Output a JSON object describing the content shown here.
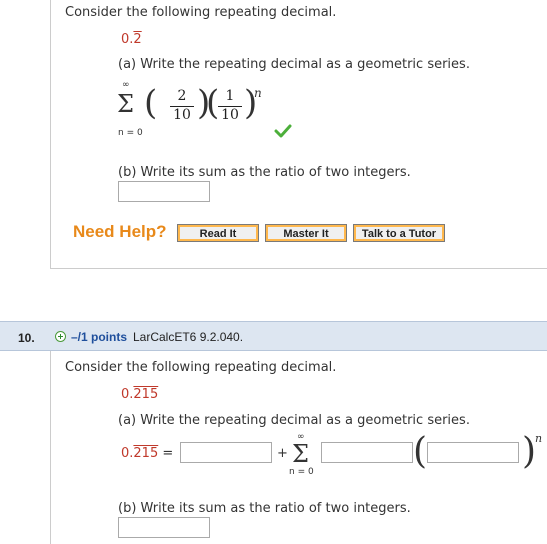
{
  "q9": {
    "prompt": "Consider the following repeating decimal.",
    "decimal_int": "0.",
    "decimal_rep": "2",
    "part_a": "(a) Write the repeating decimal as a geometric series.",
    "sum_upper": "∞",
    "sum_lower": "n = 0",
    "frac1_num": "2",
    "frac1_den": "10",
    "frac2_num": "1",
    "frac2_den": "10",
    "exponent": "n",
    "part_b": "(b) Write its sum as the ratio of two integers.",
    "need_help": "Need Help?",
    "buttons": [
      "Read It",
      "Master It",
      "Talk to a Tutor"
    ]
  },
  "q10": {
    "number": "10.",
    "points": "–/1 points",
    "id": "LarCalcET6 9.2.040.",
    "prompt": "Consider the following repeating decimal.",
    "decimal_int": "0.",
    "decimal_rep": "215",
    "part_a": "(a) Write the repeating decimal as a geometric series.",
    "eq_left_int": "0.",
    "eq_left_rep": "215",
    "equals": "=",
    "plus": "+",
    "sum_upper": "∞",
    "sum_lower": "n = 0",
    "exponent": "n",
    "part_b": "(b) Write its sum as the ratio of two integers."
  },
  "colors": {
    "accent_red": "#c0392b",
    "help_orange": "#e8891a",
    "header_blue": "#dde6f1",
    "points_blue": "#1f4f9c",
    "check_green": "#4caf3a"
  }
}
